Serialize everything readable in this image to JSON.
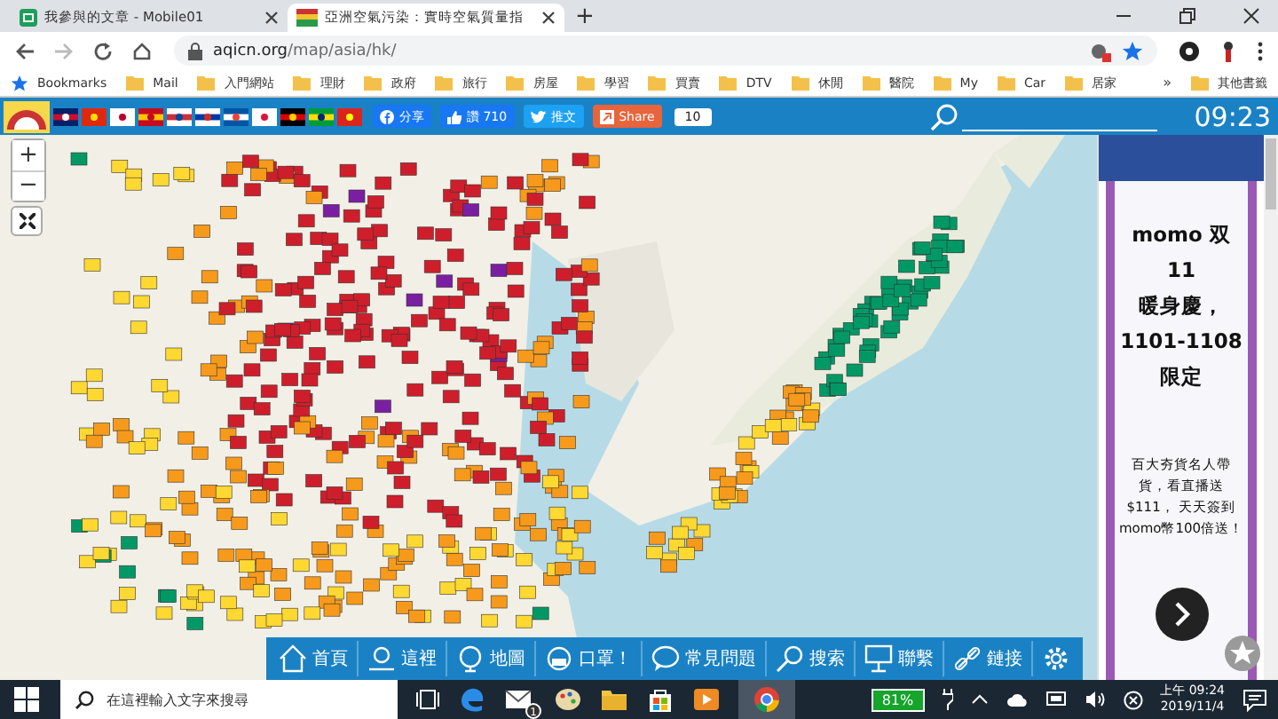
{
  "browser": {
    "tabs": [
      {
        "title": "我參與的文章 - Mobile01",
        "selected": false
      },
      {
        "title": "亞洲空氣污染：實時空氣質量指",
        "selected": true
      }
    ],
    "new_tab": "+",
    "url_host": "aqicn.org",
    "url_path": "/map/asia/hk/",
    "bookmarks": [
      {
        "label": "Bookmarks",
        "kind": "star"
      },
      {
        "label": "Mail",
        "kind": "folder"
      },
      {
        "label": "入門網站",
        "kind": "folder"
      },
      {
        "label": "理財",
        "kind": "folder"
      },
      {
        "label": "政府",
        "kind": "folder"
      },
      {
        "label": "旅行",
        "kind": "folder"
      },
      {
        "label": "房屋",
        "kind": "folder"
      },
      {
        "label": "學習",
        "kind": "folder"
      },
      {
        "label": "買賣",
        "kind": "folder"
      },
      {
        "label": "DTV",
        "kind": "folder"
      },
      {
        "label": "休閒",
        "kind": "folder"
      },
      {
        "label": "醫院",
        "kind": "folder"
      },
      {
        "label": "My",
        "kind": "folder"
      },
      {
        "label": "Car",
        "kind": "folder"
      },
      {
        "label": "居家",
        "kind": "folder"
      }
    ],
    "bookmarks_more": "»",
    "other_bookmarks": "其他書籤"
  },
  "site_bar": {
    "share_facebook": "分享",
    "like": "讚 710",
    "tweet": "推文",
    "share": "Share",
    "share_count": "10",
    "clock": "09:23"
  },
  "map": {
    "zoom_in": "+",
    "zoom_out": "−"
  },
  "ad": {
    "headline": [
      "momo 双11",
      "暖身慶，",
      "1101-1108",
      "限定"
    ],
    "body": "百大夯貨名人帶貨，看直播送$111， 天天簽到momo幣100倍送！"
  },
  "nav": [
    {
      "label": "首頁",
      "kind": "home"
    },
    {
      "label": "這裡",
      "kind": "pin"
    },
    {
      "label": "地圖",
      "kind": "globe"
    },
    {
      "label": "口罩！",
      "kind": "mask"
    },
    {
      "label": "常見問題",
      "kind": "chat"
    },
    {
      "label": "搜索",
      "kind": "search"
    },
    {
      "label": "聯繫",
      "kind": "contact"
    },
    {
      "label": "鏈接",
      "kind": "link"
    }
  ],
  "taskbar": {
    "search_placeholder": "在這裡輸入文字來搜尋",
    "mail_badge": "1",
    "battery": "81%",
    "time": "上午 09:24",
    "date": "2019/11/4"
  }
}
